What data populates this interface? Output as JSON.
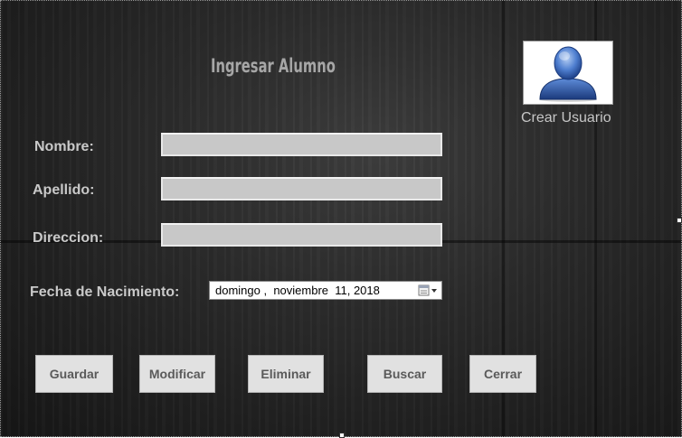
{
  "form": {
    "title": "Ingresar Alumno",
    "fields": {
      "nombre_label": "Nombre:",
      "apellido_label": "Apellido:",
      "direccion_label": "Direccion:",
      "fecha_label": "Fecha de Nacimiento:",
      "nombre_value": "",
      "apellido_value": "",
      "direccion_value": "",
      "fecha_value": "domingo ,  noviembre  11, 2018"
    },
    "buttons": {
      "guardar": "Guardar",
      "modificar": "Modificar",
      "eliminar": "Eliminar",
      "buscar": "Buscar",
      "cerrar": "Cerrar"
    },
    "user": {
      "caption": "Crear Usuario",
      "icon": "user-avatar-icon"
    }
  },
  "colors": {
    "background": "#2b2b2b",
    "title": "#a6a6a6",
    "label": "#c9c9c9",
    "textbox": "#c8c8c8",
    "button": "#e1e1e1",
    "avatar_blue": "#2f5fb0"
  }
}
